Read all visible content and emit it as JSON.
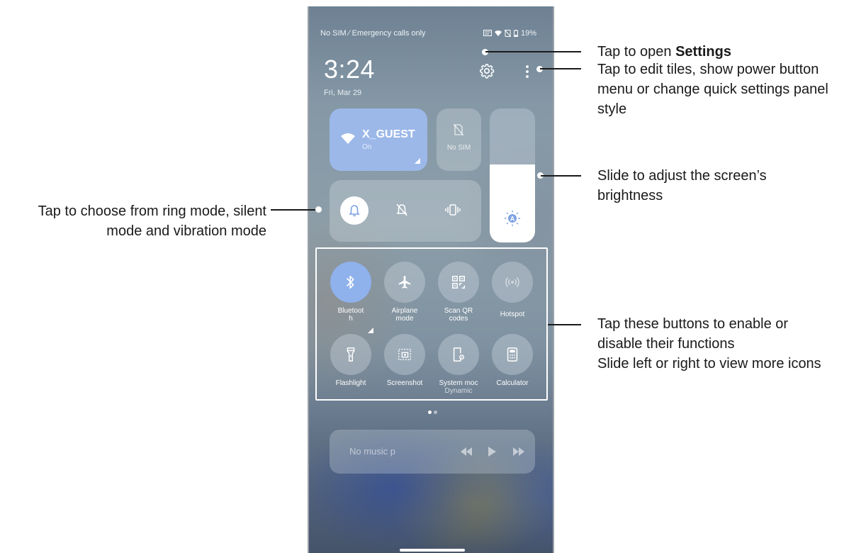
{
  "status_bar": {
    "carrier": "No SIM ⁄ Emergency calls only",
    "battery": "19%"
  },
  "header": {
    "time": "3:24",
    "date": "Fri, Mar 29"
  },
  "tiles": {
    "wifi": {
      "ssid": "X_GUEST",
      "state": "On"
    },
    "sim": {
      "label": "No SIM"
    },
    "brightness_level": 0.58
  },
  "quick_buttons": [
    {
      "label": "Bluetoot\nh",
      "sub": "",
      "icon": "bluetooth-icon",
      "active": true
    },
    {
      "label": "Airplane\nmode",
      "sub": "",
      "icon": "airplane-icon",
      "active": false
    },
    {
      "label": "Scan QR\ncodes",
      "sub": "",
      "icon": "qr-code-icon",
      "active": false
    },
    {
      "label": "Hotspot",
      "sub": "",
      "icon": "hotspot-icon",
      "active": false
    },
    {
      "label": "Flashlight",
      "sub": "",
      "icon": "flashlight-icon",
      "active": false
    },
    {
      "label": "Screenshot",
      "sub": "",
      "icon": "screenshot-icon",
      "active": false
    },
    {
      "label": "System moc",
      "sub": "Dynamic",
      "icon": "system-mode-icon",
      "active": false
    },
    {
      "label": "Calculator",
      "sub": "",
      "icon": "calculator-icon",
      "active": false
    }
  ],
  "media": {
    "title": "No music p"
  },
  "callouts": {
    "settings_prefix": "Tap to open ",
    "settings_bold": "Settings",
    "menu_line1": "Tap to edit tiles, show power button",
    "menu_line2": "menu or change quick settings panel",
    "menu_line3": "style",
    "brightness_line1": "Slide to adjust the screen’s",
    "brightness_line2": "brightness",
    "sound_line1": "Tap to choose from ring mode, silent",
    "sound_line2": "mode and vibration mode",
    "buttons_line1": "Tap these buttons to enable or",
    "buttons_line2": "disable their functions",
    "buttons_line3": "Slide left or right to view more icons"
  },
  "colors": {
    "accent_active": "#8fb1ec",
    "wifi_tile": "#9cb8e9",
    "callout_text": "#1a1a1a"
  }
}
